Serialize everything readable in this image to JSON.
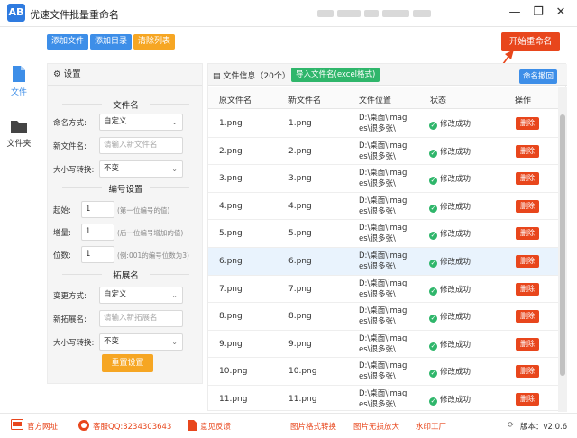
{
  "app": {
    "logo_text": "AB",
    "title": "优速文件批量重命名"
  },
  "window_controls": {
    "minimize": "—",
    "restore": "❐",
    "close": "✕"
  },
  "toolbar": {
    "add_file": "添加文件",
    "add_dir": "添加目录",
    "clear_list": "清除列表",
    "start_rename": "开始重命名"
  },
  "nav": [
    {
      "label": "文件",
      "icon": "file-icon",
      "active": true
    },
    {
      "label": "文件夹",
      "icon": "folder-icon",
      "active": false
    }
  ],
  "settings": {
    "header": "设置",
    "filename_section": "文件名",
    "naming_mode_label": "命名方式:",
    "naming_mode_value": "自定义",
    "new_name_label": "新文件名:",
    "new_name_placeholder": "请输入新文件名",
    "case_label": "大小写转换:",
    "case_value": "不变",
    "number_section": "编号设置",
    "start_label": "起始:",
    "start_value": "1",
    "start_hint": "(第一位编号的值)",
    "step_label": "增量:",
    "step_value": "1",
    "step_hint": "(后一位编号增加的值)",
    "digits_label": "位数:",
    "digits_value": "1",
    "digits_hint": "(例:001的编号位数为3)",
    "ext_section": "拓展名",
    "ext_mode_label": "变更方式:",
    "ext_mode_value": "自定义",
    "new_ext_label": "新拓展名:",
    "new_ext_placeholder": "请输入新拓展名",
    "ext_case_label": "大小写转换:",
    "ext_case_value": "不变",
    "reset_button": "重置设置"
  },
  "file_panel": {
    "info": "文件信息（20个）",
    "import_button": "导入文件名(excel格式)",
    "undo_button": "命名撤回",
    "columns": [
      "原文件名",
      "新文件名",
      "文件位置",
      "状态",
      "操作"
    ],
    "status_text": "修改成功",
    "delete_label": "删除",
    "rows": [
      {
        "original": "1.png",
        "new": "1.png",
        "location_line1": "D:\\桌面\\imag",
        "location_line2": "es\\很多张\\"
      },
      {
        "original": "2.png",
        "new": "2.png",
        "location_line1": "D:\\桌面\\imag",
        "location_line2": "es\\很多张\\"
      },
      {
        "original": "3.png",
        "new": "3.png",
        "location_line1": "D:\\桌面\\imag",
        "location_line2": "es\\很多张\\"
      },
      {
        "original": "4.png",
        "new": "4.png",
        "location_line1": "D:\\桌面\\imag",
        "location_line2": "es\\很多张\\"
      },
      {
        "original": "5.png",
        "new": "5.png",
        "location_line1": "D:\\桌面\\imag",
        "location_line2": "es\\很多张\\"
      },
      {
        "original": "6.png",
        "new": "6.png",
        "location_line1": "D:\\桌面\\imag",
        "location_line2": "es\\很多张\\"
      },
      {
        "original": "7.png",
        "new": "7.png",
        "location_line1": "D:\\桌面\\imag",
        "location_line2": "es\\很多张\\"
      },
      {
        "original": "8.png",
        "new": "8.png",
        "location_line1": "D:\\桌面\\imag",
        "location_line2": "es\\很多张\\"
      },
      {
        "original": "9.png",
        "new": "9.png",
        "location_line1": "D:\\桌面\\imag",
        "location_line2": "es\\很多张\\"
      },
      {
        "original": "10.png",
        "new": "10.png",
        "location_line1": "D:\\桌面\\imag",
        "location_line2": "es\\很多张\\"
      },
      {
        "original": "11.png",
        "new": "11.png",
        "location_line1": "D:\\桌面\\imag",
        "location_line2": "es\\很多张\\"
      }
    ],
    "highlighted_row": 5
  },
  "footer": {
    "official_site": "官方网址",
    "support_qq": "客服QQ:3234303643",
    "feedback": "意见反馈",
    "img_convert": "图片格式转换",
    "img_compress": "图片无损放大",
    "watermark": "水印工厂",
    "version": "版本：v2.0.6"
  },
  "colors": {
    "accent_blue": "#3d8ee8",
    "accent_orange": "#f6a623",
    "danger_red": "#e8461c",
    "success_green": "#2fb66b"
  }
}
